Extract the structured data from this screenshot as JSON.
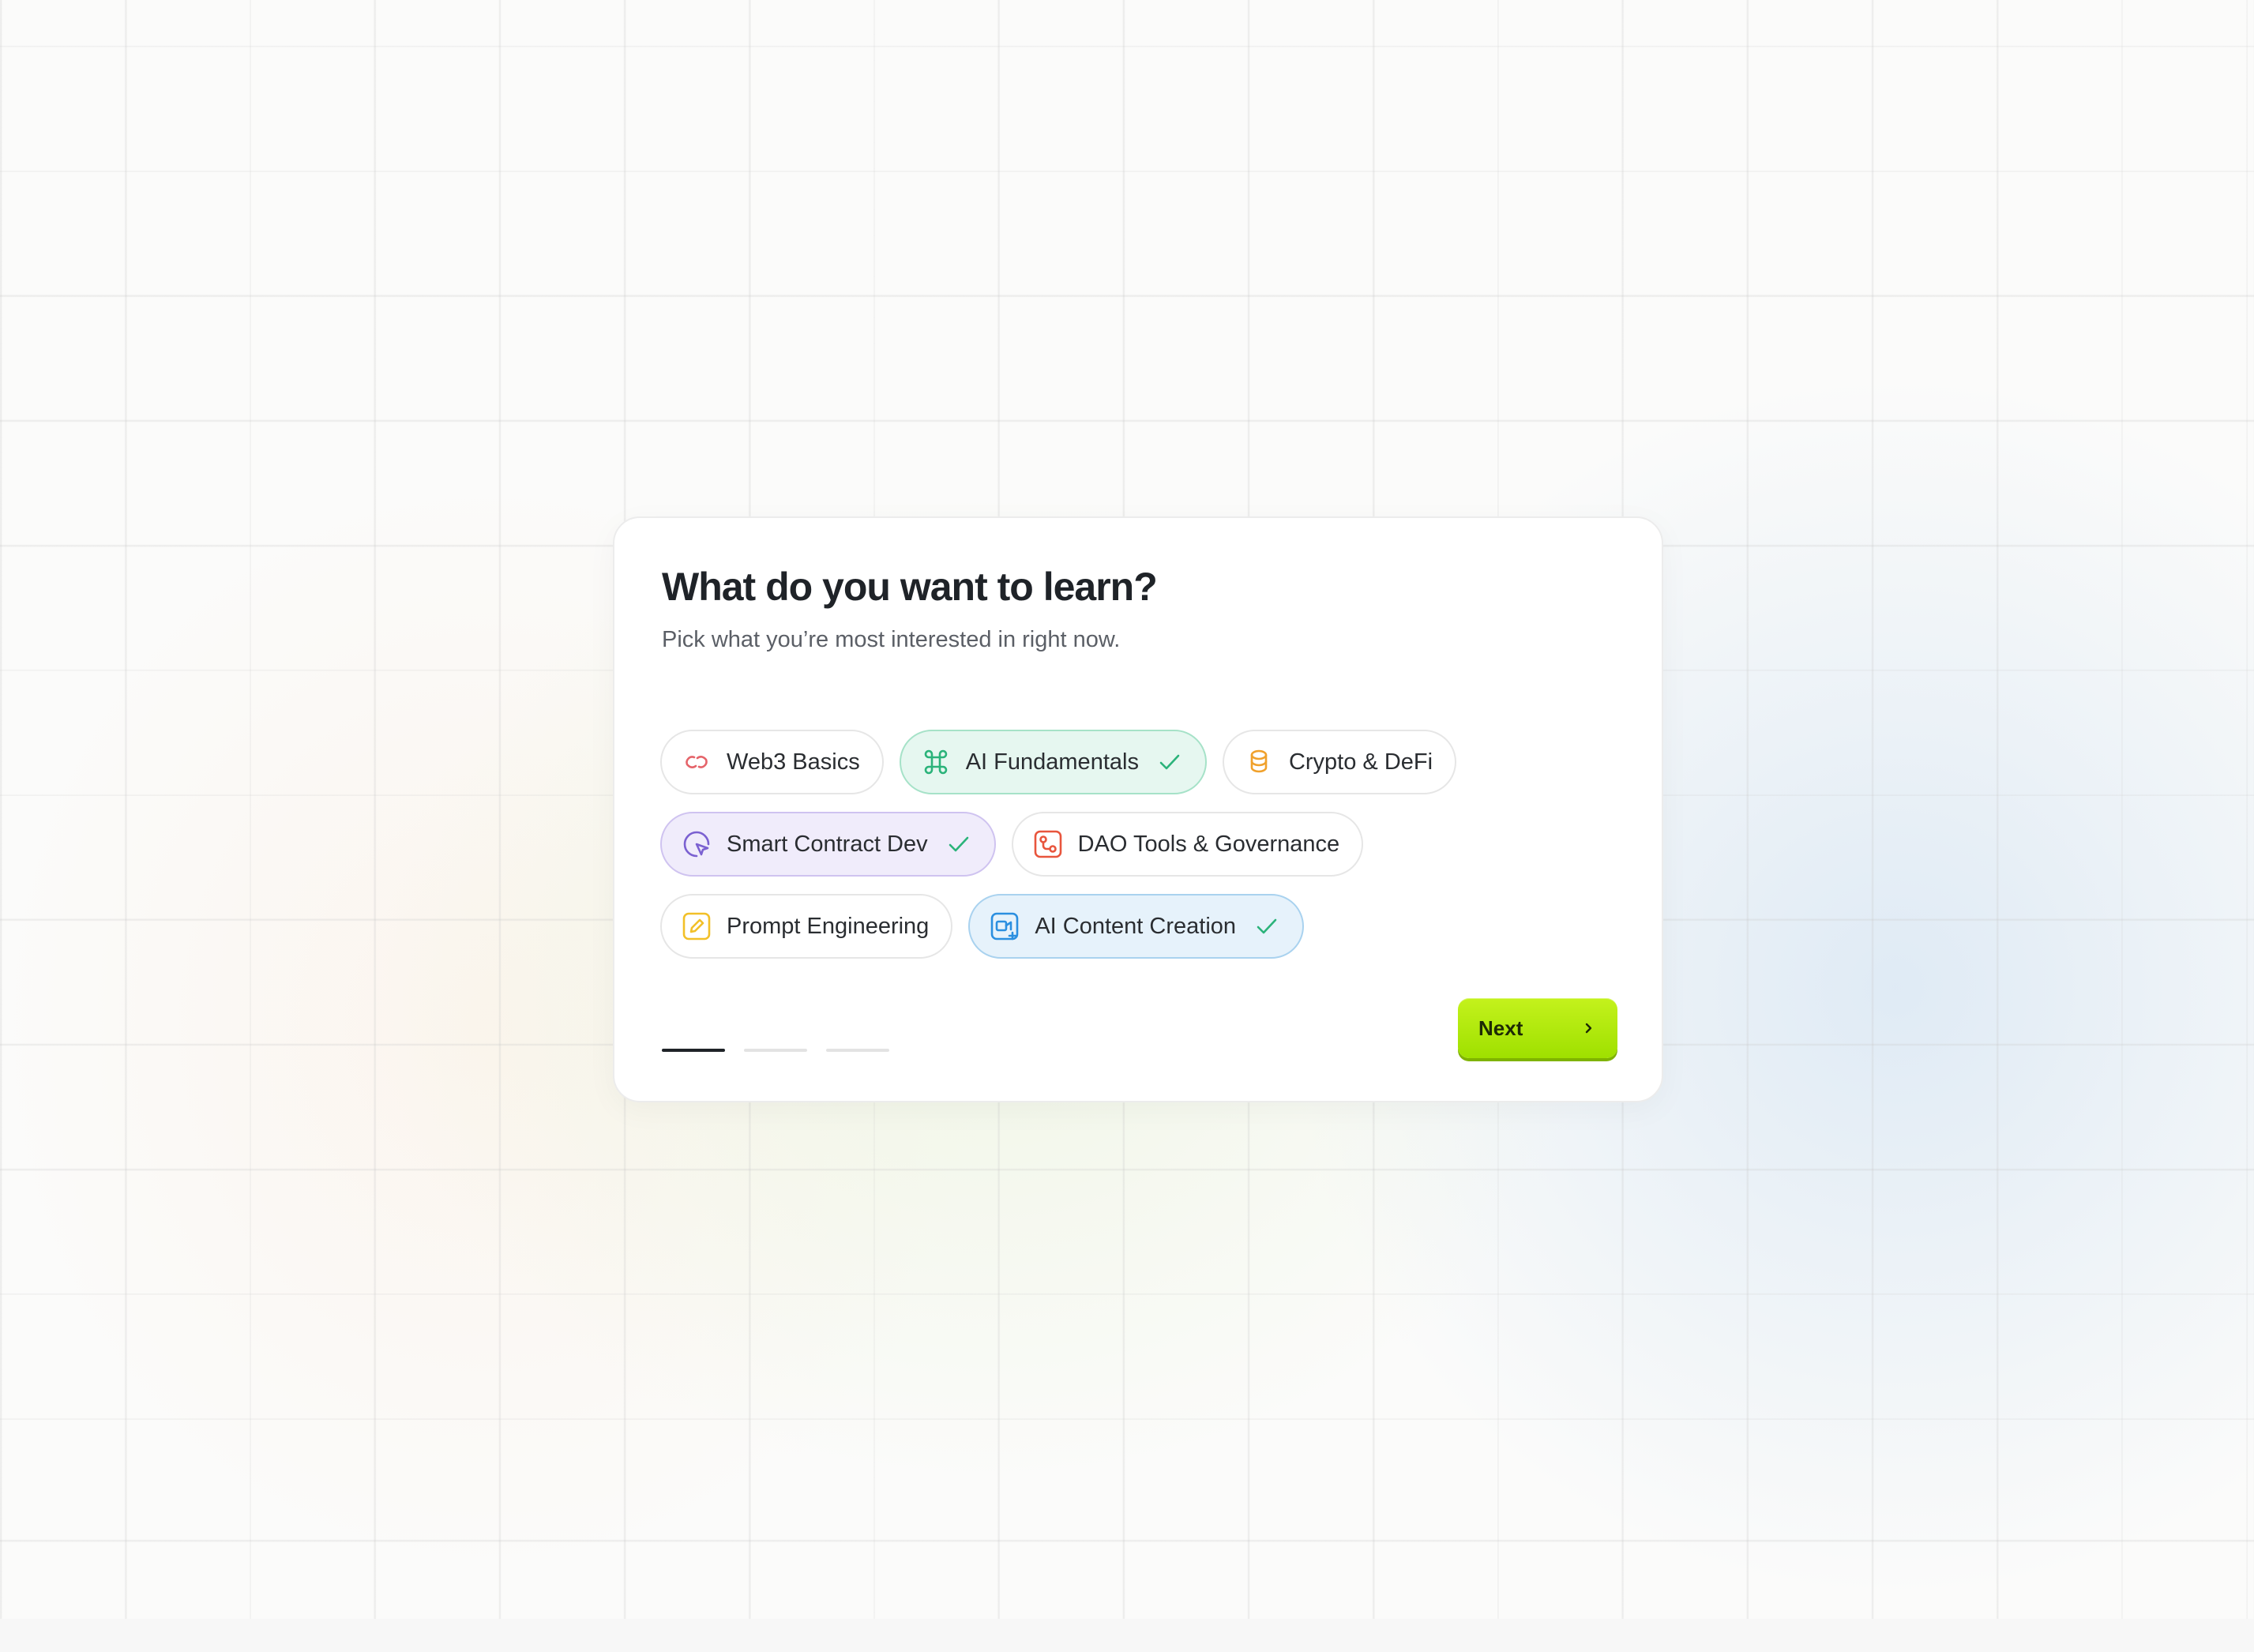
{
  "card": {
    "title": "What do you want to learn?",
    "subtitle": "Pick what you’re most interested in right now."
  },
  "topics": [
    {
      "label": "Web3 Basics",
      "icon": "link-icon",
      "selected": false,
      "color": "#e5646a"
    },
    {
      "label": "AI Fundamentals",
      "icon": "command-icon",
      "selected": true,
      "color": "#2bb37a"
    },
    {
      "label": "Crypto & DeFi",
      "icon": "coins-icon",
      "selected": false,
      "color": "#f0a12c"
    },
    {
      "label": "Smart Contract Dev",
      "icon": "pointer-circle-icon",
      "selected": true,
      "color": "#7b61d1"
    },
    {
      "label": "DAO Tools & Governance",
      "icon": "workflow-icon",
      "selected": false,
      "color": "#e8553d"
    },
    {
      "label": "Prompt Engineering",
      "icon": "pencil-square-icon",
      "selected": false,
      "color": "#f2c028"
    },
    {
      "label": "AI Content Creation",
      "icon": "video-sparkle-icon",
      "selected": true,
      "color": "#2b8fe0"
    }
  ],
  "progress": {
    "total_steps": 3,
    "current_step": 1
  },
  "next_button": {
    "label": "Next",
    "icon": "chevron-right-icon",
    "color": "#b5ec0e"
  }
}
